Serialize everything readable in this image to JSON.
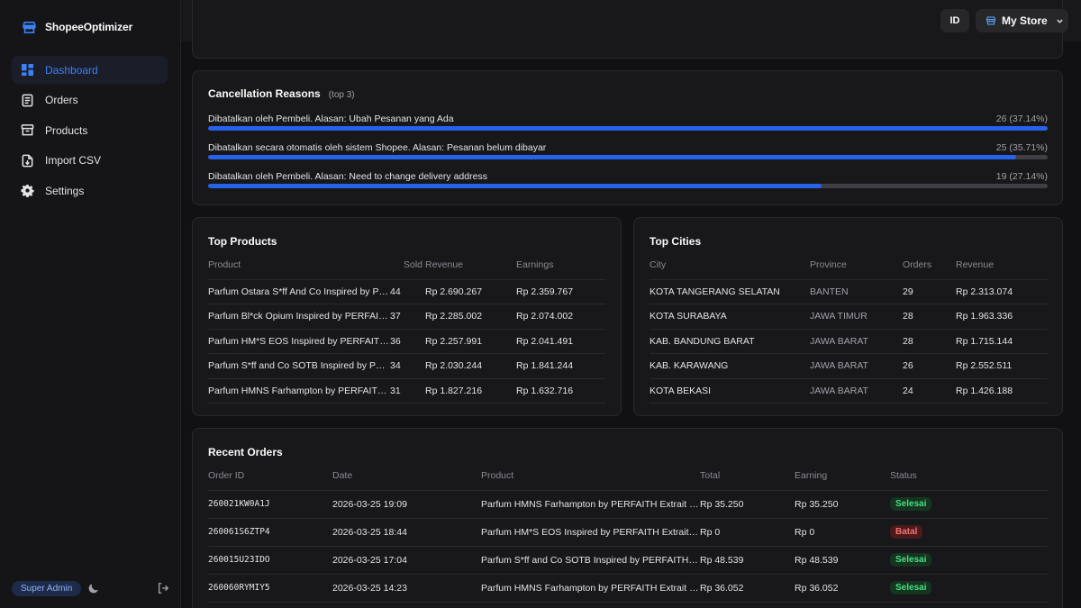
{
  "app": {
    "brand": "ShopeeOptimizer"
  },
  "sidebar": {
    "items": [
      {
        "label": "Dashboard",
        "icon": "dashboard-icon",
        "active": true
      },
      {
        "label": "Orders",
        "icon": "orders-icon"
      },
      {
        "label": "Products",
        "icon": "products-icon"
      },
      {
        "label": "Import CSV",
        "icon": "import-icon"
      },
      {
        "label": "Settings",
        "icon": "gear-icon"
      }
    ],
    "role": "Super Admin"
  },
  "topbar": {
    "language": "ID",
    "store": "My Store"
  },
  "cancellation": {
    "title": "Cancellation Reasons",
    "subtitle": "(top 3)",
    "rows": [
      {
        "label": "Dibatalkan oleh Pembeli. Alasan: Ubah Pesanan yang Ada",
        "value": "26 (37.14%)",
        "fraction": 1.0
      },
      {
        "label": "Dibatalkan secara otomatis oleh sistem Shopee. Alasan: Pesanan belum dibayar",
        "value": "25 (35.71%)",
        "fraction": 0.962
      },
      {
        "label": "Dibatalkan oleh Pembeli. Alasan: Need to change delivery address",
        "value": "19 (27.14%)",
        "fraction": 0.731
      }
    ]
  },
  "top_products": {
    "title": "Top Products",
    "headers": [
      "Product",
      "Sold",
      "Revenue",
      "Earnings"
    ],
    "rows": [
      [
        "Parfum Ostara S*ff And Co Inspired by PERFAITH Extrait De Parfum",
        "44",
        "Rp 2.690.267",
        "Rp 2.359.767"
      ],
      [
        "Parfum Bl*ck Opium Inspired by PERFAITH Extrait De Parfum",
        "37",
        "Rp 2.285.002",
        "Rp 2.074.002"
      ],
      [
        "Parfum HM*S EOS Inspired by PERFAITH Extrait De Parfum",
        "36",
        "Rp 2.257.991",
        "Rp 2.041.491"
      ],
      [
        "Parfum S*ff and Co SOTB Inspired by PERFAITH Extrait De Parfum",
        "34",
        "Rp 2.030.244",
        "Rp 1.841.244"
      ],
      [
        "Parfum HMNS Farhampton by PERFAITH Extrait De Parfum",
        "31",
        "Rp 1.827.216",
        "Rp 1.632.716"
      ]
    ]
  },
  "top_cities": {
    "title": "Top Cities",
    "headers": [
      "City",
      "Province",
      "Orders",
      "Revenue"
    ],
    "rows": [
      [
        "KOTA TANGERANG SELATAN",
        "BANTEN",
        "29",
        "Rp 2.313.074"
      ],
      [
        "KOTA SURABAYA",
        "JAWA TIMUR",
        "28",
        "Rp 1.963.336"
      ],
      [
        "KAB. BANDUNG BARAT",
        "JAWA BARAT",
        "28",
        "Rp 1.715.144"
      ],
      [
        "KAB. KARAWANG",
        "JAWA BARAT",
        "26",
        "Rp 2.552.511"
      ],
      [
        "KOTA BEKASI",
        "JAWA BARAT",
        "24",
        "Rp 1.426.188"
      ]
    ]
  },
  "recent_orders": {
    "title": "Recent Orders",
    "headers": [
      "Order ID",
      "Date",
      "Product",
      "Total",
      "Earning",
      "Status"
    ],
    "rows": [
      [
        "260021KW0A1J",
        "2026-03-25 19:09",
        "Parfum HMNS Farhampton by PERFAITH Extrait De Parfum",
        "Rp 35.250",
        "Rp 35.250",
        "Selesai"
      ],
      [
        "260061S6ZTP4",
        "2026-03-25 18:44",
        "Parfum HM*S EOS Inspired by PERFAITH Extrait De Parfum",
        "Rp 0",
        "Rp 0",
        "Batal"
      ],
      [
        "260015U23IDO",
        "2026-03-25 17:04",
        "Parfum S*ff and Co SOTB Inspired by PERFAITH Extrait De Parfum",
        "Rp 48.539",
        "Rp 48.539",
        "Selesai"
      ],
      [
        "260060RYMIY5",
        "2026-03-25 14:23",
        "Parfum HMNS Farhampton by PERFAITH Extrait De Parfum",
        "Rp 36.052",
        "Rp 36.052",
        "Selesai"
      ]
    ]
  },
  "colors": {
    "accent": "#2563eb",
    "success": "#4ade80",
    "danger": "#f87171"
  }
}
